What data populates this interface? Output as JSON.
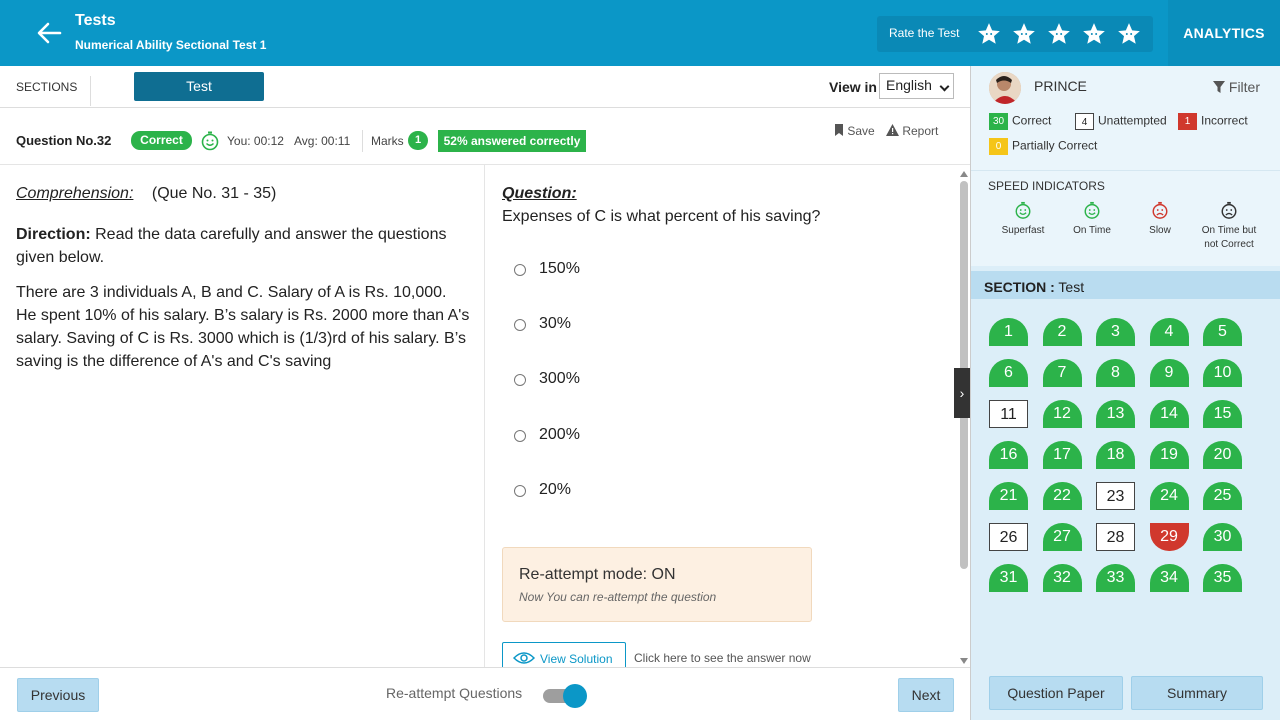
{
  "header": {
    "title": "Tests",
    "subtitle": "Numerical Ability Sectional Test 1",
    "rate_label": "Rate the Test",
    "analytics_label": "ANALYTICS"
  },
  "sections": {
    "label": "SECTIONS",
    "active_tab": "Test",
    "view_in_label": "View in",
    "language": "English"
  },
  "question_bar": {
    "number": "Question No.32",
    "status": "Correct",
    "you_time": "You: 00:12",
    "avg_time": "Avg: 00:11",
    "marks_label": "Marks",
    "marks_value": "1",
    "percent_correct": "52% answered correctly",
    "save_label": "Save",
    "report_label": "Report"
  },
  "comprehension": {
    "heading": "Comprehension:",
    "range": "(Que No. 31 - 35)",
    "direction_label": "Direction:",
    "direction_text": "Read the data carefully and answer the questions given below.",
    "body": "There are 3 individuals A, B and C. Salary of A is Rs. 10,000. He spent 10% of his salary. B’s salary is Rs. 2000 more than A's salary. Saving of C is Rs. 3000 which is (1/3)rd of his salary. B’s saving is the difference of A's and C's saving"
  },
  "question": {
    "heading": "Question:",
    "text": "Expenses of C is what percent of his saving?",
    "options": [
      "150%",
      "30%",
      "300%",
      "200%",
      "20%"
    ]
  },
  "reattempt": {
    "title": "Re-attempt mode: ON",
    "subtitle": "Now You can re-attempt the question"
  },
  "solution": {
    "view_label": "View Solution",
    "hint": "Click here to see the answer now"
  },
  "footer": {
    "previous": "Previous",
    "reattempt_questions": "Re-attempt Questions",
    "reattempt_on": true,
    "next": "Next"
  },
  "sidebar": {
    "user": "PRINCE",
    "filter_label": "Filter",
    "legend": {
      "correct_count": "30",
      "correct_label": "Correct",
      "unattempted_count": "4",
      "unattempted_label": "Unattempted",
      "incorrect_count": "1",
      "incorrect_label": "Incorrect",
      "partial_count": "0",
      "partial_label": "Partially Correct"
    },
    "speed_heading": "SPEED INDICATORS",
    "speed": [
      {
        "label": "Superfast",
        "icon": "smile-timer-icon",
        "color": "#2cb34a"
      },
      {
        "label": "On Time",
        "icon": "smile-timer-icon",
        "color": "#2cb34a"
      },
      {
        "label": "Slow",
        "icon": "sad-timer-icon",
        "color": "#d0382d"
      },
      {
        "label": "On Time but not Correct",
        "icon": "sad-timer-icon",
        "color": "#333333"
      }
    ],
    "section_label": "SECTION :",
    "section_name": "Test",
    "questions": [
      {
        "n": "1",
        "s": "correct"
      },
      {
        "n": "2",
        "s": "correct"
      },
      {
        "n": "3",
        "s": "correct"
      },
      {
        "n": "4",
        "s": "correct"
      },
      {
        "n": "5",
        "s": "correct"
      },
      {
        "n": "6",
        "s": "correct"
      },
      {
        "n": "7",
        "s": "correct"
      },
      {
        "n": "8",
        "s": "correct"
      },
      {
        "n": "9",
        "s": "correct"
      },
      {
        "n": "10",
        "s": "correct"
      },
      {
        "n": "11",
        "s": "unattempted"
      },
      {
        "n": "12",
        "s": "correct"
      },
      {
        "n": "13",
        "s": "correct"
      },
      {
        "n": "14",
        "s": "correct"
      },
      {
        "n": "15",
        "s": "correct"
      },
      {
        "n": "16",
        "s": "correct"
      },
      {
        "n": "17",
        "s": "correct"
      },
      {
        "n": "18",
        "s": "correct"
      },
      {
        "n": "19",
        "s": "correct"
      },
      {
        "n": "20",
        "s": "correct"
      },
      {
        "n": "21",
        "s": "correct"
      },
      {
        "n": "22",
        "s": "correct"
      },
      {
        "n": "23",
        "s": "unattempted"
      },
      {
        "n": "24",
        "s": "correct"
      },
      {
        "n": "25",
        "s": "correct"
      },
      {
        "n": "26",
        "s": "unattempted"
      },
      {
        "n": "27",
        "s": "correct"
      },
      {
        "n": "28",
        "s": "unattempted"
      },
      {
        "n": "29",
        "s": "incorrect"
      },
      {
        "n": "30",
        "s": "correct"
      },
      {
        "n": "31",
        "s": "correct"
      },
      {
        "n": "32",
        "s": "correct"
      },
      {
        "n": "33",
        "s": "correct"
      },
      {
        "n": "34",
        "s": "correct"
      },
      {
        "n": "35",
        "s": "correct"
      }
    ],
    "question_paper": "Question Paper",
    "summary": "Summary"
  },
  "colors": {
    "header": "#0b97c7",
    "correct": "#2cb34a",
    "incorrect": "#d0382d",
    "partial": "#f5c518"
  }
}
